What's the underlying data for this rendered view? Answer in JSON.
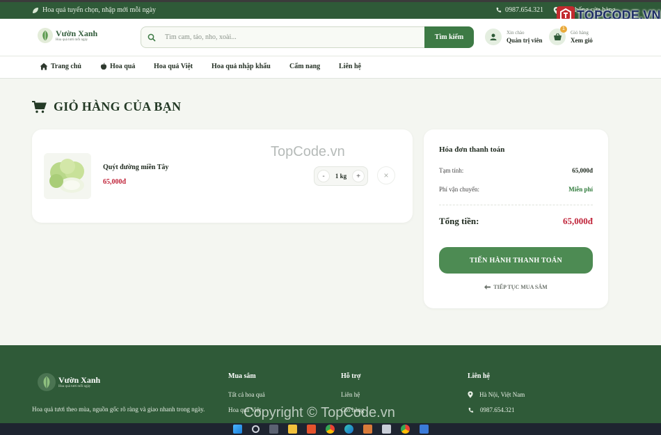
{
  "topbar": {
    "tagline": "Hoa quả tuyển chọn, nhập mới mỗi ngày",
    "phone": "0987.654.321",
    "store_link": "Hệ thống cửa hàng"
  },
  "brand": {
    "name": "Vườn Xanh",
    "tagline": "Hoa quả tươi mỗi ngày"
  },
  "search": {
    "placeholder": "Tìm cam, táo, nho, xoài...",
    "button": "Tìm kiếm"
  },
  "account": {
    "greeting": "Xin chào",
    "name": "Quản trị viên"
  },
  "cart_header": {
    "label": "Giỏ hàng",
    "action": "Xem giỏ",
    "count": "1"
  },
  "nav": [
    "Trang chủ",
    "Hoa quả",
    "Hoa quả Việt",
    "Hoa quả nhập khẩu",
    "Cẩm nang",
    "Liên hệ"
  ],
  "page": {
    "title": "GIỎ HÀNG CỦA BẠN"
  },
  "cart_items": [
    {
      "name": "Quýt đường miền Tây",
      "price": "65,000đ",
      "quantity": "1 kg",
      "minus": "-",
      "plus": "+",
      "remove": "×"
    }
  ],
  "invoice": {
    "title": "Hóa đơn thanh toán",
    "subtotal_label": "Tạm tính:",
    "subtotal": "65,000đ",
    "shipping_label": "Phí vận chuyển:",
    "shipping": "Miễn phí",
    "total_label": "Tổng tiền:",
    "total": "65,000đ",
    "checkout": "TIẾN HÀNH THANH TOÁN",
    "continue": "TIẾP TỤC MUA SẮM"
  },
  "footer": {
    "description": "Hoa quả tươi theo mùa, nguồn gốc rõ ràng và giao nhanh trong ngày.",
    "shop_title": "Mua sắm",
    "shop_links": [
      "Tất cả hoa quả",
      "Hoa quả Việt"
    ],
    "support_title": "Hỗ trợ",
    "support_links": [
      "Liên hệ",
      "Giỏ hàng"
    ],
    "contact_title": "Liên hệ",
    "address": "Hà Nội, Việt Nam",
    "phone": "0987.654.321"
  },
  "watermarks": {
    "center": "TopCode.vn",
    "bottom": "Copyright © TopCode.vn",
    "logo": "TOPCODE.VN"
  },
  "colors": {
    "primary": "#2f5a38",
    "accent": "#4d8b53",
    "price": "#c0243a"
  }
}
